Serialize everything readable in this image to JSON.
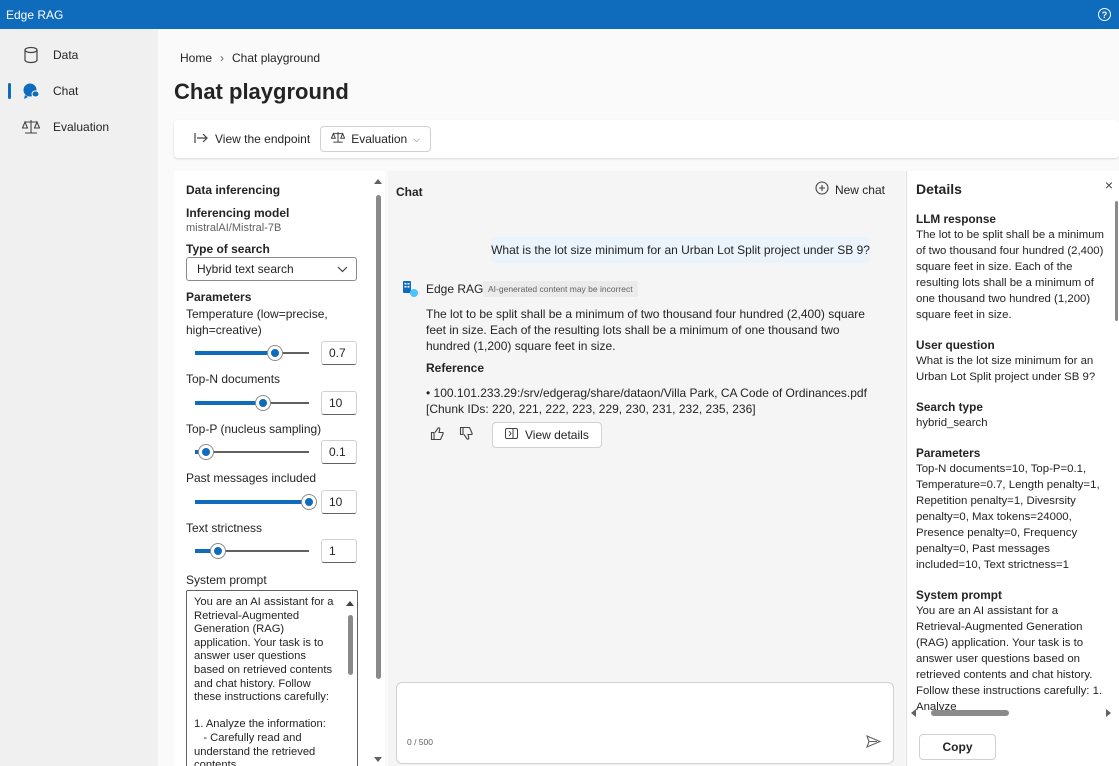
{
  "app": {
    "title": "Edge RAG"
  },
  "nav": {
    "items": [
      {
        "label": "Data",
        "icon": "database-icon"
      },
      {
        "label": "Chat",
        "icon": "chat-icon",
        "active": true
      },
      {
        "label": "Evaluation",
        "icon": "scale-icon"
      }
    ]
  },
  "breadcrumb": {
    "home": "Home",
    "current": "Chat playground"
  },
  "page": {
    "title": "Chat playground"
  },
  "toolbar": {
    "view_endpoint": "View the endpoint",
    "evaluation": "Evaluation"
  },
  "settings": {
    "section_title": "Data inferencing",
    "model_label": "Inferencing model",
    "model_value": "mistralAI/Mistral-7B",
    "search_type_label": "Type of search",
    "search_type_value": "Hybrid text search",
    "parameters_label": "Parameters",
    "sliders": [
      {
        "label": "Temperature (low=precise, high=creative)",
        "value": "0.7",
        "fraction": 0.7
      },
      {
        "label": "Top-N documents",
        "value": "10",
        "fraction": 0.6
      },
      {
        "label": "Top-P (nucleus sampling)",
        "value": "0.1",
        "fraction": 0.1
      },
      {
        "label": "Past messages included",
        "value": "10",
        "fraction": 1.0
      },
      {
        "label": "Text strictness",
        "value": "1",
        "fraction": 0.2
      }
    ],
    "system_prompt_label": "System prompt",
    "system_prompt": "You are an AI assistant for a Retrieval-Augmented Generation (RAG) application. Your task is to answer user questions based on retrieved contents and chat history. Follow these instructions carefully:\n\n1. Analyze the information:\n   - Carefully read and understand the retrieved contents"
  },
  "chat": {
    "title": "Chat",
    "new_chat": "New chat",
    "user_message": "What is the lot size minimum for an Urban Lot Split project under SB 9?",
    "bot_name": "Edge RAG",
    "ai_badge": "AI-generated content may be incorrect",
    "bot_response": "The lot to be split shall be a minimum of two thousand four hundred (2,400) square feet in size. Each of the resulting lots shall be a minimum of one thousand two hundred (1,200) square feet in size.",
    "reference_title": "Reference",
    "reference_text": "• 100.101.233.29:/srv/edgerag/share/dataon/Villa Park, CA Code of Ordinances.pdf [Chunk IDs: 220, 221, 222, 223, 229, 230, 231, 232, 235, 236]",
    "view_details": "View details",
    "char_count": "0 / 500"
  },
  "details": {
    "title": "Details",
    "sections": [
      {
        "heading": "LLM response",
        "body": "The lot to be split shall be a minimum of two thousand four hundred (2,400) square feet in size. Each of the resulting lots shall be a minimum of one thousand two hundred (1,200) square feet in size."
      },
      {
        "heading": "User question",
        "body": "What is the lot size minimum for an Urban Lot Split project under SB 9?"
      },
      {
        "heading": "Search type",
        "body": "hybrid_search"
      },
      {
        "heading": "Parameters",
        "body": "Top-N documents=10, Top-P=0.1, Temperature=0.7, Length penalty=1, Repetition penalty=1, Divesrsity penalty=0, Max tokens=24000, Presence penalty=0, Frequency penalty=0, Past messages included=10, Text strictness=1"
      },
      {
        "heading": "System prompt",
        "body": "You are an AI assistant for a Retrieval-Augmented Generation (RAG) application. Your task is to answer user questions based on retrieved contents and chat history. Follow these instructions carefully: 1. Analyze"
      }
    ],
    "copy": "Copy"
  },
  "colors": {
    "brand": "#0f6cbd",
    "user_bubble": "#ebf3fc"
  }
}
